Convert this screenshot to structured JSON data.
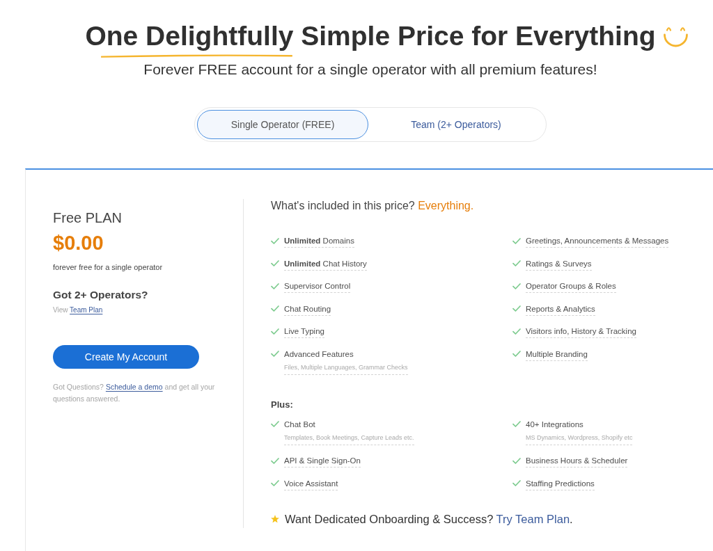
{
  "header": {
    "title": "One Delightfully Simple Price for Everything",
    "subtitle": "Forever FREE account for a single operator with all premium features!"
  },
  "tabs": [
    {
      "label": "Single Operator (FREE)",
      "selected": true
    },
    {
      "label": "Team (2+ Operators)",
      "selected": false
    }
  ],
  "plan": {
    "name": "Free PLAN",
    "price": "$0.00",
    "price_note": "forever free for a single operator",
    "team_question": "Got 2+ Operators?",
    "team_prefix": "View",
    "team_link": "Team Plan",
    "cta_button": "Create My Account",
    "help_prefix": "Got Questions?",
    "help_link": "Schedule a demo",
    "help_suffix": "and get all your questions answered."
  },
  "included": {
    "heading": "What's included in this price?",
    "highlight": "Everything.",
    "features": [
      {
        "label": "**Unlimited** Domains"
      },
      {
        "label": "Greetings, Announcements & Messages"
      },
      {
        "label": "**Unlimited** Chat History"
      },
      {
        "label": "Ratings & Surveys"
      },
      {
        "label": "Supervisor Control"
      },
      {
        "label": "Operator Groups & Roles"
      },
      {
        "label": "Chat Routing"
      },
      {
        "label": "Reports & Analytics"
      },
      {
        "label": "Live Typing"
      },
      {
        "label": "Visitors info, History & Tracking"
      },
      {
        "label": "Advanced Features",
        "note": "Files, Multiple Languages, Grammar Checks"
      },
      {
        "label": "Multiple Branding"
      }
    ]
  },
  "plus": {
    "heading": "Plus:",
    "features": [
      {
        "label": "Chat Bot",
        "note": "Templates, Book Meetings, Capture Leads etc."
      },
      {
        "label": "40+ Integrations",
        "note": "MS Dynamics, Wordpress, Shopify etc"
      },
      {
        "label": "API & Single Sign-On"
      },
      {
        "label": "Business Hours & Scheduler"
      },
      {
        "label": "Voice Assistant"
      },
      {
        "label": "Staffing Predictions"
      }
    ]
  },
  "onboarding": {
    "text": "Want Dedicated Onboarding & Success?",
    "link": "Try Team Plan",
    "suffix": "."
  }
}
